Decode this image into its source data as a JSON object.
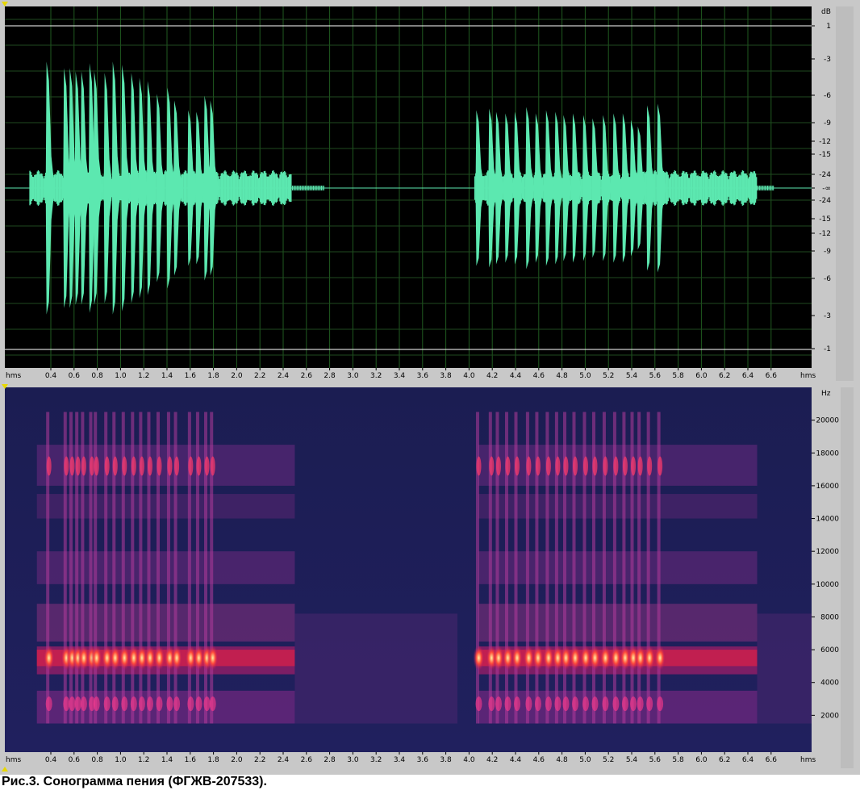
{
  "caption": "Рис.3. Сонограмма пения (ФГЖВ-207533).",
  "colors": {
    "waveform": "#5ce8b0",
    "wave_background": "#000000",
    "spec_background": "#1a1d55",
    "grid": "#1f5a1f",
    "clip_line": "#ffffff",
    "ruler_bg": "#c8c8c8"
  },
  "chart_data": [
    {
      "type": "area",
      "title": "",
      "units_label": "dB",
      "time_unit_label": "hms",
      "x_ticks": [
        "0.4",
        "0.6",
        "0.8",
        "1.0",
        "1.2",
        "1.4",
        "1.6",
        "1.8",
        "2.0",
        "2.2",
        "2.4",
        "2.6",
        "2.8",
        "3.0",
        "3.2",
        "3.4",
        "3.6",
        "3.8",
        "4.0",
        "4.2",
        "4.4",
        "4.6",
        "4.8",
        "5.0",
        "5.2",
        "5.4",
        "5.6",
        "5.8",
        "6.0",
        "6.2",
        "6.4",
        "6.6"
      ],
      "y_tick_labels": [
        "1",
        "-3",
        "-6",
        "-9",
        "-12",
        "-15",
        "-24",
        "-∞",
        "-24",
        "-15",
        "-12",
        "-9",
        "-6",
        "-3",
        "-1"
      ],
      "xlim": [
        0.22,
        7.15
      ],
      "ylim": [
        -1,
        1
      ],
      "grid": true,
      "series": [
        {
          "x": [
            0.37,
            0.52,
            0.57,
            0.62,
            0.67,
            0.74,
            0.78,
            0.87,
            0.94,
            1.02,
            1.1,
            1.17,
            1.24,
            1.32,
            1.41,
            1.47,
            1.59,
            1.66,
            1.73,
            1.78
          ],
          "values": [
            0.78,
            0.74,
            0.74,
            0.72,
            0.72,
            0.77,
            0.72,
            0.71,
            0.78,
            0.76,
            0.71,
            0.68,
            0.66,
            0.58,
            0.62,
            0.54,
            0.48,
            0.47,
            0.57,
            0.54
          ]
        },
        {
          "x": [
            4.07,
            4.18,
            4.24,
            4.32,
            4.4,
            4.5,
            4.58,
            4.67,
            4.75,
            4.82,
            4.9,
            4.99,
            5.07,
            5.16,
            5.25,
            5.33,
            5.4,
            5.46,
            5.54,
            5.63
          ],
          "values": [
            0.48,
            0.49,
            0.47,
            0.46,
            0.47,
            0.5,
            0.46,
            0.48,
            0.47,
            0.45,
            0.46,
            0.45,
            0.43,
            0.45,
            0.46,
            0.46,
            0.42,
            0.38,
            0.51,
            0.52
          ]
        }
      ]
    },
    {
      "type": "heatmap",
      "title": "",
      "units_label": "Hz",
      "time_unit_label": "hms",
      "y_ticks": [
        2000,
        4000,
        6000,
        8000,
        10000,
        12000,
        14000,
        16000,
        18000,
        20000
      ],
      "x_ticks": [
        "0.4",
        "0.6",
        "0.8",
        "1.0",
        "1.2",
        "1.4",
        "1.6",
        "1.8",
        "2.0",
        "2.2",
        "2.4",
        "2.6",
        "2.8",
        "3.0",
        "3.2",
        "3.4",
        "3.6",
        "3.8",
        "4.0",
        "4.2",
        "4.4",
        "4.6",
        "4.8",
        "5.0",
        "5.2",
        "5.4",
        "5.6",
        "5.8",
        "6.0",
        "6.2",
        "6.4",
        "6.6"
      ],
      "ylim": [
        0,
        22000
      ],
      "bands_hz": [
        [
          1500,
          3500
        ],
        [
          4500,
          6200
        ],
        [
          6500,
          8800
        ],
        [
          10000,
          12000
        ],
        [
          14000,
          15500
        ],
        [
          16000,
          18500
        ]
      ],
      "dominant_band_hz": [
        5000,
        6000
      ]
    }
  ]
}
